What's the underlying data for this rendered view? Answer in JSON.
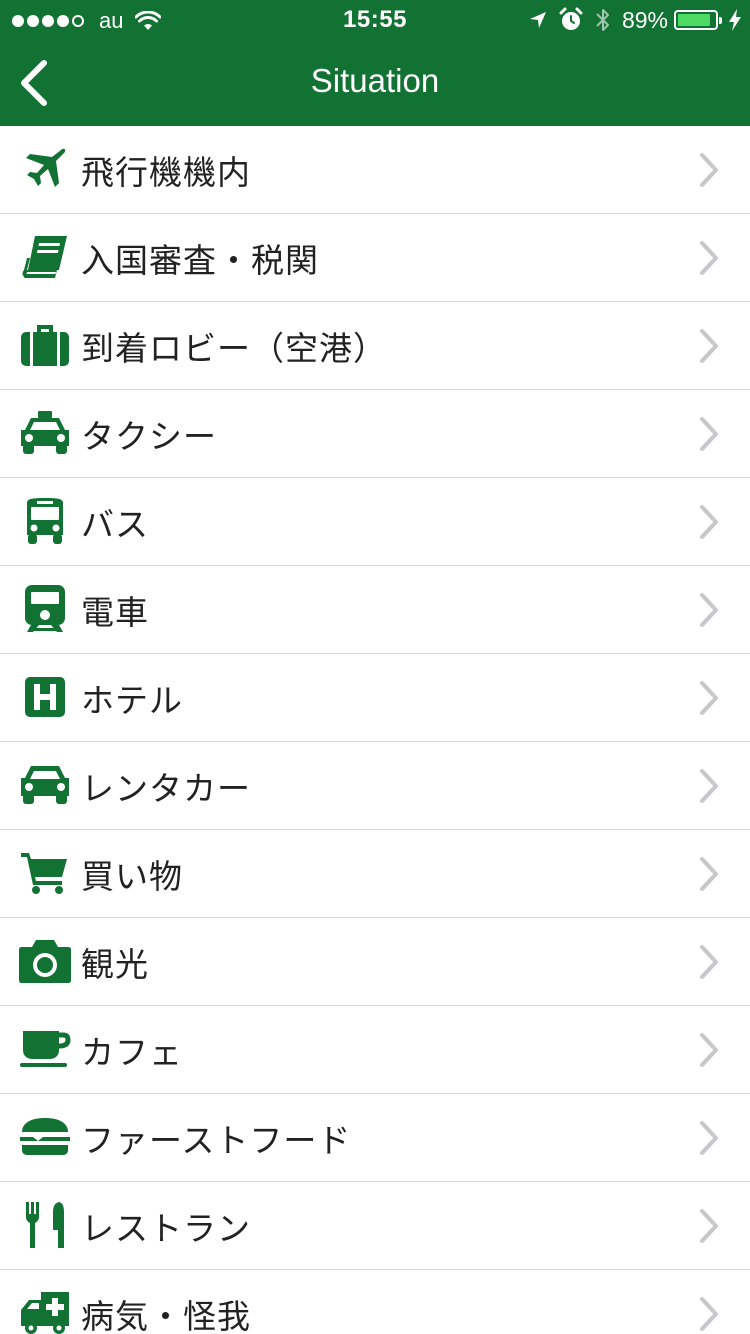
{
  "status_bar": {
    "carrier": "au",
    "time": "15:55",
    "battery_percent": "89%",
    "battery_level": 0.89,
    "signal_bars_filled": 4,
    "signal_bars_total": 5
  },
  "nav": {
    "title": "Situation",
    "back_icon": "chevron-left-icon"
  },
  "colors": {
    "brand_green": "#127233",
    "icon_green": "#127233",
    "chevron_gray": "#c7c7cc",
    "battery_green": "#4cd964"
  },
  "situations": [
    {
      "id": "airplane",
      "label": "飛行機機内",
      "icon": "airplane-icon"
    },
    {
      "id": "immigration",
      "label": "入国審査・税関",
      "icon": "passport-book-icon"
    },
    {
      "id": "arrival-lobby",
      "label": "到着ロビー（空港）",
      "icon": "suitcase-icon"
    },
    {
      "id": "taxi",
      "label": "タクシー",
      "icon": "taxi-icon"
    },
    {
      "id": "bus",
      "label": "バス",
      "icon": "bus-icon"
    },
    {
      "id": "train",
      "label": "電車",
      "icon": "train-icon"
    },
    {
      "id": "hotel",
      "label": "ホテル",
      "icon": "hotel-icon"
    },
    {
      "id": "rental-car",
      "label": "レンタカー",
      "icon": "car-icon"
    },
    {
      "id": "shopping",
      "label": "買い物",
      "icon": "shopping-cart-icon"
    },
    {
      "id": "sightseeing",
      "label": "観光",
      "icon": "camera-icon"
    },
    {
      "id": "cafe",
      "label": "カフェ",
      "icon": "coffee-cup-icon"
    },
    {
      "id": "fast-food",
      "label": "ファーストフード",
      "icon": "hamburger-icon"
    },
    {
      "id": "restaurant",
      "label": "レストラン",
      "icon": "fork-knife-icon"
    },
    {
      "id": "illness-injury",
      "label": "病気・怪我",
      "icon": "ambulance-icon"
    }
  ]
}
